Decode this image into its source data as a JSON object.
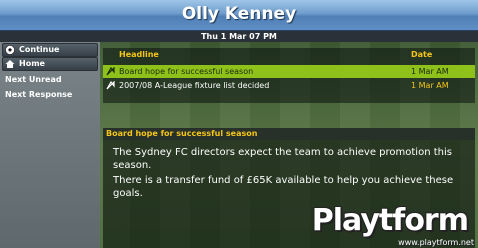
{
  "header": {
    "title": "Olly Kenney",
    "date": "Thu 1 Mar 07 PM"
  },
  "sidebar": {
    "buttons": [
      {
        "label": "Continue",
        "icon": "soccer-ball-icon"
      },
      {
        "label": "Home",
        "icon": "home-icon"
      }
    ],
    "links": [
      "Next Unread",
      "Next Response"
    ]
  },
  "news": {
    "columns": {
      "headline": "Headline",
      "date": "Date"
    },
    "rows": [
      {
        "headline": "Board hope for successful season",
        "date": "1 Mar AM",
        "selected": true
      },
      {
        "headline": "2007/08 A-League fixture list decided",
        "date": "1 Mar AM",
        "selected": false
      }
    ]
  },
  "detail": {
    "title": "Board hope for successful season",
    "paragraphs": [
      "The Sydney FC directors expect the team to achieve promotion this season.",
      "There is a transfer fund of £65K available to help you achieve these goals."
    ]
  },
  "watermark": {
    "brand": "Playtform",
    "url": "www.playtform.net"
  },
  "colors": {
    "header_blue": "#6e9ccc",
    "selected_row": "#8ec21a",
    "heading_yellow": "#f5c518"
  }
}
